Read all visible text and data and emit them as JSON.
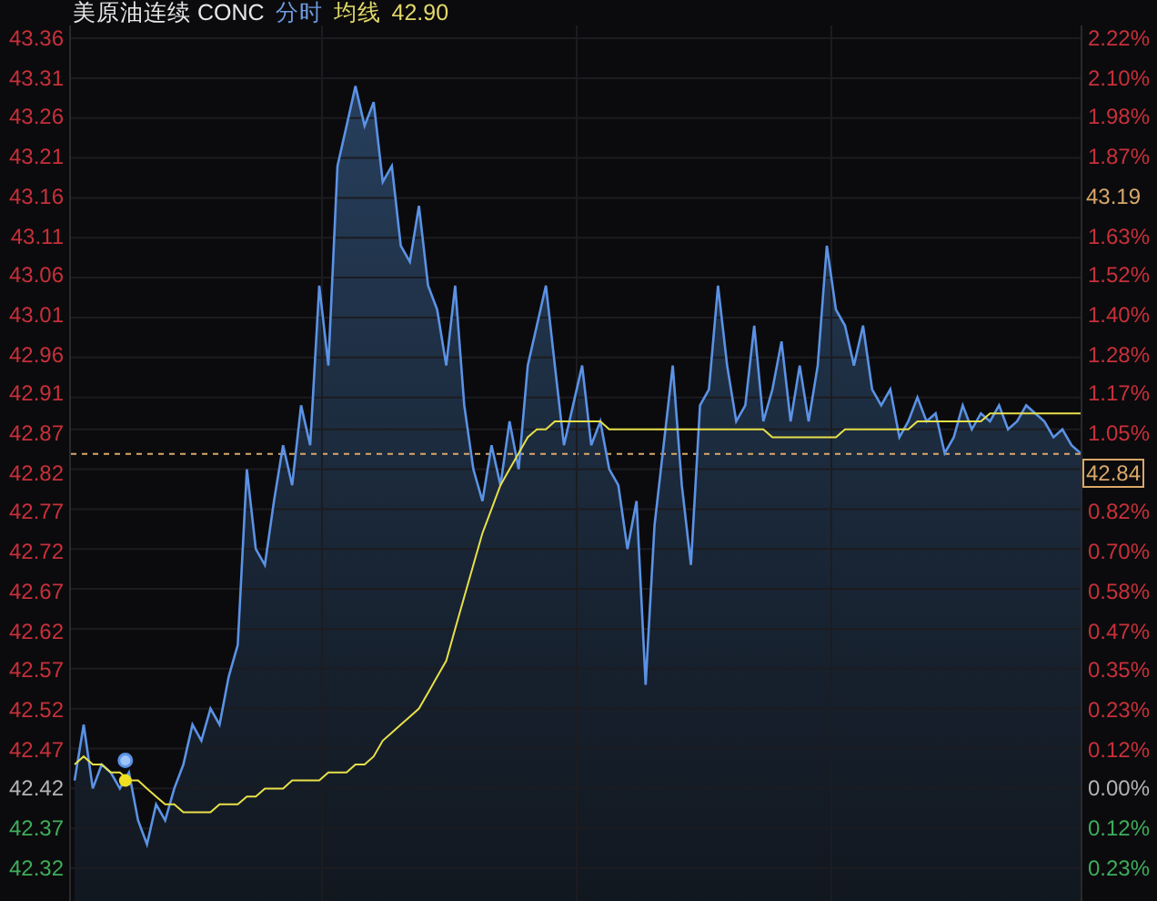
{
  "header": {
    "instrument": "美原油连续 CONC",
    "mode": "分时",
    "average_label": "均线",
    "average_value": "42.90"
  },
  "axis_left": [
    {
      "label": "43.36",
      "color": "#c8303a"
    },
    {
      "label": "43.31",
      "color": "#c8303a"
    },
    {
      "label": "43.26",
      "color": "#c8303a"
    },
    {
      "label": "43.21",
      "color": "#c8303a"
    },
    {
      "label": "43.16",
      "color": "#c8303a"
    },
    {
      "label": "43.11",
      "color": "#c8303a"
    },
    {
      "label": "43.06",
      "color": "#c8303a"
    },
    {
      "label": "43.01",
      "color": "#c8303a"
    },
    {
      "label": "42.96",
      "color": "#c8303a"
    },
    {
      "label": "42.91",
      "color": "#c8303a"
    },
    {
      "label": "42.87",
      "color": "#c8303a"
    },
    {
      "label": "42.82",
      "color": "#c8303a"
    },
    {
      "label": "42.77",
      "color": "#c8303a"
    },
    {
      "label": "42.72",
      "color": "#c8303a"
    },
    {
      "label": "42.67",
      "color": "#c8303a"
    },
    {
      "label": "42.62",
      "color": "#c8303a"
    },
    {
      "label": "42.57",
      "color": "#c8303a"
    },
    {
      "label": "42.52",
      "color": "#c8303a"
    },
    {
      "label": "42.47",
      "color": "#c8303a"
    },
    {
      "label": "42.42",
      "color": "#b4b4b4"
    },
    {
      "label": "42.37",
      "color": "#3fae5a"
    },
    {
      "label": "42.32",
      "color": "#3fae5a"
    }
  ],
  "axis_right": [
    {
      "kind": "tick",
      "label": "2.22%",
      "color": "#c8303a"
    },
    {
      "kind": "tick",
      "label": "2.10%",
      "color": "#c8303a"
    },
    {
      "kind": "tick",
      "label": "1.98%",
      "color": "#c8303a"
    },
    {
      "kind": "tick",
      "label": "1.87%",
      "color": "#c8303a"
    },
    {
      "kind": "marker",
      "label": "43.19",
      "color": "#d9a86a"
    },
    {
      "kind": "tick",
      "label": "1.63%",
      "color": "#c8303a"
    },
    {
      "kind": "tick",
      "label": "1.52%",
      "color": "#c8303a"
    },
    {
      "kind": "tick",
      "label": "1.40%",
      "color": "#c8303a"
    },
    {
      "kind": "tick",
      "label": "1.28%",
      "color": "#c8303a"
    },
    {
      "kind": "tick",
      "label": "1.17%",
      "color": "#c8303a"
    },
    {
      "kind": "tick",
      "label": "1.05%",
      "color": "#c8303a"
    },
    {
      "kind": "box",
      "label": "42.84",
      "color": "#d9a86a"
    },
    {
      "kind": "tick",
      "label": "0.82%",
      "color": "#c8303a"
    },
    {
      "kind": "tick",
      "label": "0.70%",
      "color": "#c8303a"
    },
    {
      "kind": "tick",
      "label": "0.58%",
      "color": "#c8303a"
    },
    {
      "kind": "tick",
      "label": "0.47%",
      "color": "#c8303a"
    },
    {
      "kind": "tick",
      "label": "0.35%",
      "color": "#c8303a"
    },
    {
      "kind": "tick",
      "label": "0.23%",
      "color": "#c8303a"
    },
    {
      "kind": "tick",
      "label": "0.12%",
      "color": "#c8303a"
    },
    {
      "kind": "tick",
      "label": "0.00%",
      "color": "#b4b4b4"
    },
    {
      "kind": "tick",
      "label": "0.12%",
      "color": "#3fae5a"
    },
    {
      "kind": "tick",
      "label": "0.23%",
      "color": "#3fae5a"
    }
  ],
  "chart_data": {
    "type": "line",
    "grid": true,
    "ylim": [
      42.279,
      43.376
    ],
    "yticks": [
      43.36,
      43.31,
      43.26,
      43.21,
      43.16,
      43.11,
      43.06,
      43.01,
      42.96,
      42.91,
      42.87,
      42.82,
      42.77,
      42.72,
      42.67,
      42.62,
      42.57,
      42.52,
      42.47,
      42.42,
      42.37,
      42.32
    ],
    "series": [
      {
        "color": "#5b92e5",
        "values": [
          42.43,
          42.5,
          42.42,
          42.45,
          42.44,
          42.42,
          42.44,
          42.38,
          42.35,
          42.4,
          42.38,
          42.42,
          42.45,
          42.5,
          42.48,
          42.52,
          42.5,
          42.56,
          42.6,
          42.82,
          42.72,
          42.7,
          42.78,
          42.85,
          42.8,
          42.9,
          42.85,
          43.05,
          42.95,
          43.2,
          43.25,
          43.3,
          43.25,
          43.28,
          43.18,
          43.2,
          43.1,
          43.08,
          43.15,
          43.05,
          43.02,
          42.95,
          43.05,
          42.9,
          42.82,
          42.78,
          42.85,
          42.8,
          42.88,
          42.82,
          42.95,
          43.0,
          43.05,
          42.95,
          42.85,
          42.9,
          42.95,
          42.85,
          42.88,
          42.82,
          42.8,
          42.72,
          42.78,
          42.55,
          42.75,
          42.85,
          42.95,
          42.8,
          42.7,
          42.9,
          42.92,
          43.05,
          42.95,
          42.88,
          42.9,
          43.0,
          42.88,
          42.92,
          42.98,
          42.88,
          42.95,
          42.88,
          42.95,
          43.1,
          43.02,
          43.0,
          42.95,
          43.0,
          42.92,
          42.9,
          42.92,
          42.86,
          42.88,
          42.91,
          42.88,
          42.89,
          42.84,
          42.86,
          42.9,
          42.87,
          42.89,
          42.88,
          42.9,
          42.87,
          42.88,
          42.9,
          42.89,
          42.88,
          42.86,
          42.87,
          42.85,
          42.84
        ]
      },
      {
        "color": "#e8e04a",
        "values": [
          42.45,
          42.46,
          42.45,
          42.45,
          42.44,
          42.44,
          42.43,
          42.43,
          42.42,
          42.41,
          42.4,
          42.4,
          42.39,
          42.39,
          42.39,
          42.39,
          42.4,
          42.4,
          42.4,
          42.41,
          42.41,
          42.42,
          42.42,
          42.42,
          42.43,
          42.43,
          42.43,
          42.43,
          42.44,
          42.44,
          42.44,
          42.45,
          42.45,
          42.46,
          42.48,
          42.49,
          42.5,
          42.51,
          42.52,
          42.54,
          42.56,
          42.58,
          42.62,
          42.66,
          42.7,
          42.74,
          42.77,
          42.8,
          42.82,
          42.84,
          42.86,
          42.87,
          42.87,
          42.88,
          42.88,
          42.88,
          42.88,
          42.88,
          42.88,
          42.87,
          42.87,
          42.87,
          42.87,
          42.87,
          42.87,
          42.87,
          42.87,
          42.87,
          42.87,
          42.87,
          42.87,
          42.87,
          42.87,
          42.87,
          42.87,
          42.87,
          42.87,
          42.86,
          42.86,
          42.86,
          42.86,
          42.86,
          42.86,
          42.86,
          42.86,
          42.87,
          42.87,
          42.87,
          42.87,
          42.87,
          42.87,
          42.87,
          42.87,
          42.88,
          42.88,
          42.88,
          42.88,
          42.88,
          42.88,
          42.88,
          42.88,
          42.89,
          42.89,
          42.89,
          42.89,
          42.89,
          42.89,
          42.89,
          42.89,
          42.89,
          42.89,
          42.89
        ]
      }
    ]
  },
  "overlays": [
    {
      "kind": "ring"
    },
    {
      "kind": "dot"
    }
  ]
}
